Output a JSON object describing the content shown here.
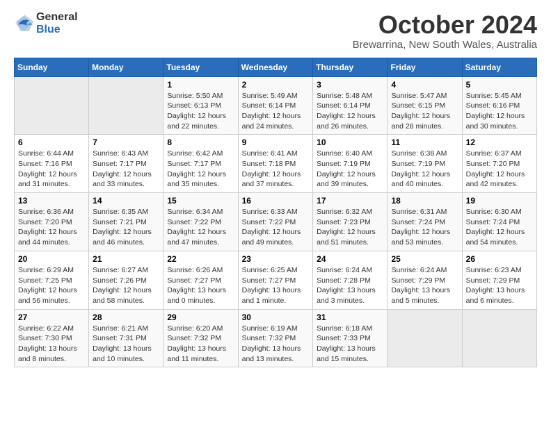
{
  "header": {
    "logo": {
      "general": "General",
      "blue": "Blue"
    },
    "title": "October 2024",
    "subtitle": "Brewarrina, New South Wales, Australia"
  },
  "calendar": {
    "days_of_week": [
      "Sunday",
      "Monday",
      "Tuesday",
      "Wednesday",
      "Thursday",
      "Friday",
      "Saturday"
    ],
    "weeks": [
      [
        {
          "day": "",
          "empty": true
        },
        {
          "day": "",
          "empty": true
        },
        {
          "day": "1",
          "line1": "Sunrise: 5:50 AM",
          "line2": "Sunset: 6:13 PM",
          "line3": "Daylight: 12 hours",
          "line4": "and 22 minutes."
        },
        {
          "day": "2",
          "line1": "Sunrise: 5:49 AM",
          "line2": "Sunset: 6:14 PM",
          "line3": "Daylight: 12 hours",
          "line4": "and 24 minutes."
        },
        {
          "day": "3",
          "line1": "Sunrise: 5:48 AM",
          "line2": "Sunset: 6:14 PM",
          "line3": "Daylight: 12 hours",
          "line4": "and 26 minutes."
        },
        {
          "day": "4",
          "line1": "Sunrise: 5:47 AM",
          "line2": "Sunset: 6:15 PM",
          "line3": "Daylight: 12 hours",
          "line4": "and 28 minutes."
        },
        {
          "day": "5",
          "line1": "Sunrise: 5:45 AM",
          "line2": "Sunset: 6:16 PM",
          "line3": "Daylight: 12 hours",
          "line4": "and 30 minutes."
        }
      ],
      [
        {
          "day": "6",
          "line1": "Sunrise: 6:44 AM",
          "line2": "Sunset: 7:16 PM",
          "line3": "Daylight: 12 hours",
          "line4": "and 31 minutes."
        },
        {
          "day": "7",
          "line1": "Sunrise: 6:43 AM",
          "line2": "Sunset: 7:17 PM",
          "line3": "Daylight: 12 hours",
          "line4": "and 33 minutes."
        },
        {
          "day": "8",
          "line1": "Sunrise: 6:42 AM",
          "line2": "Sunset: 7:17 PM",
          "line3": "Daylight: 12 hours",
          "line4": "and 35 minutes."
        },
        {
          "day": "9",
          "line1": "Sunrise: 6:41 AM",
          "line2": "Sunset: 7:18 PM",
          "line3": "Daylight: 12 hours",
          "line4": "and 37 minutes."
        },
        {
          "day": "10",
          "line1": "Sunrise: 6:40 AM",
          "line2": "Sunset: 7:19 PM",
          "line3": "Daylight: 12 hours",
          "line4": "and 39 minutes."
        },
        {
          "day": "11",
          "line1": "Sunrise: 6:38 AM",
          "line2": "Sunset: 7:19 PM",
          "line3": "Daylight: 12 hours",
          "line4": "and 40 minutes."
        },
        {
          "day": "12",
          "line1": "Sunrise: 6:37 AM",
          "line2": "Sunset: 7:20 PM",
          "line3": "Daylight: 12 hours",
          "line4": "and 42 minutes."
        }
      ],
      [
        {
          "day": "13",
          "line1": "Sunrise: 6:36 AM",
          "line2": "Sunset: 7:20 PM",
          "line3": "Daylight: 12 hours",
          "line4": "and 44 minutes."
        },
        {
          "day": "14",
          "line1": "Sunrise: 6:35 AM",
          "line2": "Sunset: 7:21 PM",
          "line3": "Daylight: 12 hours",
          "line4": "and 46 minutes."
        },
        {
          "day": "15",
          "line1": "Sunrise: 6:34 AM",
          "line2": "Sunset: 7:22 PM",
          "line3": "Daylight: 12 hours",
          "line4": "and 47 minutes."
        },
        {
          "day": "16",
          "line1": "Sunrise: 6:33 AM",
          "line2": "Sunset: 7:22 PM",
          "line3": "Daylight: 12 hours",
          "line4": "and 49 minutes."
        },
        {
          "day": "17",
          "line1": "Sunrise: 6:32 AM",
          "line2": "Sunset: 7:23 PM",
          "line3": "Daylight: 12 hours",
          "line4": "and 51 minutes."
        },
        {
          "day": "18",
          "line1": "Sunrise: 6:31 AM",
          "line2": "Sunset: 7:24 PM",
          "line3": "Daylight: 12 hours",
          "line4": "and 53 minutes."
        },
        {
          "day": "19",
          "line1": "Sunrise: 6:30 AM",
          "line2": "Sunset: 7:24 PM",
          "line3": "Daylight: 12 hours",
          "line4": "and 54 minutes."
        }
      ],
      [
        {
          "day": "20",
          "line1": "Sunrise: 6:29 AM",
          "line2": "Sunset: 7:25 PM",
          "line3": "Daylight: 12 hours",
          "line4": "and 56 minutes."
        },
        {
          "day": "21",
          "line1": "Sunrise: 6:27 AM",
          "line2": "Sunset: 7:26 PM",
          "line3": "Daylight: 12 hours",
          "line4": "and 58 minutes."
        },
        {
          "day": "22",
          "line1": "Sunrise: 6:26 AM",
          "line2": "Sunset: 7:27 PM",
          "line3": "Daylight: 13 hours",
          "line4": "and 0 minutes."
        },
        {
          "day": "23",
          "line1": "Sunrise: 6:25 AM",
          "line2": "Sunset: 7:27 PM",
          "line3": "Daylight: 13 hours",
          "line4": "and 1 minute."
        },
        {
          "day": "24",
          "line1": "Sunrise: 6:24 AM",
          "line2": "Sunset: 7:28 PM",
          "line3": "Daylight: 13 hours",
          "line4": "and 3 minutes."
        },
        {
          "day": "25",
          "line1": "Sunrise: 6:24 AM",
          "line2": "Sunset: 7:29 PM",
          "line3": "Daylight: 13 hours",
          "line4": "and 5 minutes."
        },
        {
          "day": "26",
          "line1": "Sunrise: 6:23 AM",
          "line2": "Sunset: 7:29 PM",
          "line3": "Daylight: 13 hours",
          "line4": "and 6 minutes."
        }
      ],
      [
        {
          "day": "27",
          "line1": "Sunrise: 6:22 AM",
          "line2": "Sunset: 7:30 PM",
          "line3": "Daylight: 13 hours",
          "line4": "and 8 minutes."
        },
        {
          "day": "28",
          "line1": "Sunrise: 6:21 AM",
          "line2": "Sunset: 7:31 PM",
          "line3": "Daylight: 13 hours",
          "line4": "and 10 minutes."
        },
        {
          "day": "29",
          "line1": "Sunrise: 6:20 AM",
          "line2": "Sunset: 7:32 PM",
          "line3": "Daylight: 13 hours",
          "line4": "and 11 minutes."
        },
        {
          "day": "30",
          "line1": "Sunrise: 6:19 AM",
          "line2": "Sunset: 7:32 PM",
          "line3": "Daylight: 13 hours",
          "line4": "and 13 minutes."
        },
        {
          "day": "31",
          "line1": "Sunrise: 6:18 AM",
          "line2": "Sunset: 7:33 PM",
          "line3": "Daylight: 13 hours",
          "line4": "and 15 minutes."
        },
        {
          "day": "",
          "empty": true
        },
        {
          "day": "",
          "empty": true
        }
      ]
    ]
  }
}
